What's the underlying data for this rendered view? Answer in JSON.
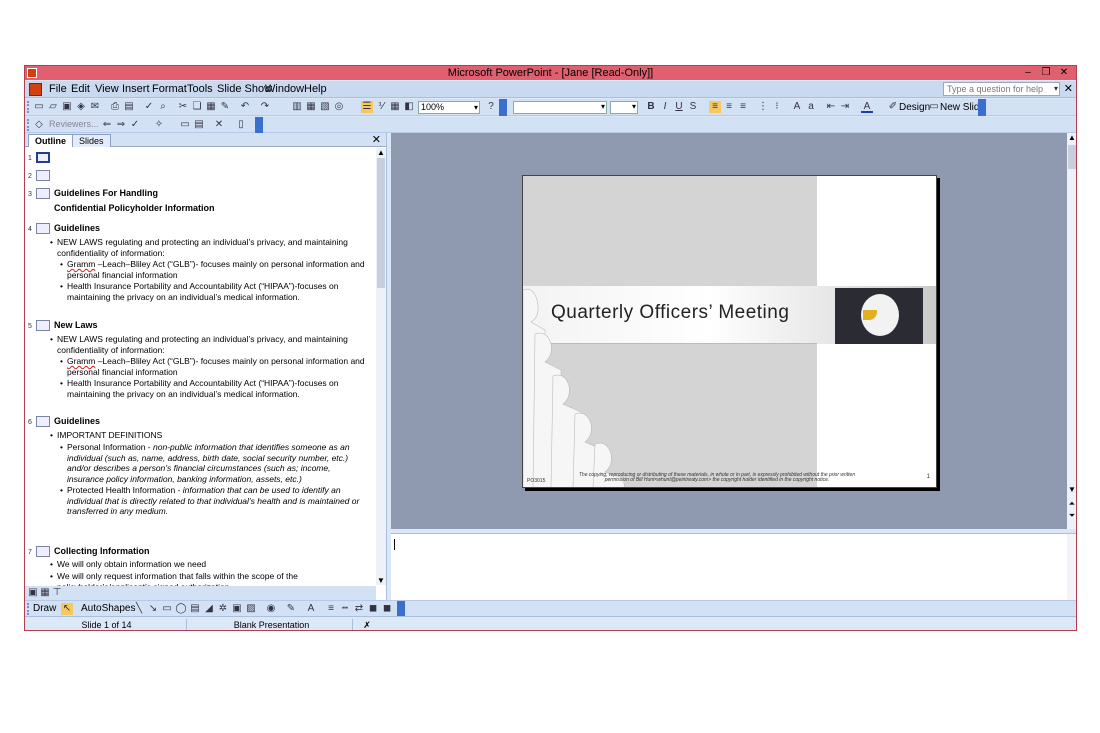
{
  "window": {
    "title": "Microsoft PowerPoint - [Jane [Read-Only]]"
  },
  "menubar": {
    "items": [
      "File",
      "Edit",
      "View",
      "Insert",
      "Format",
      "Tools",
      "Slide Show",
      "Window",
      "Help"
    ],
    "help_placeholder": "Type a question for help"
  },
  "toolbar": {
    "zoom": "100%",
    "design_label": "Design",
    "new_slide_label": "New Slide",
    "reviewers_label": "Reviewers..."
  },
  "left_pane": {
    "tabs": [
      "Outline",
      "Slides"
    ],
    "slides": [
      {
        "num": "1",
        "title": ""
      },
      {
        "num": "2",
        "title": ""
      },
      {
        "num": "3",
        "title": "Guidelines For Handling",
        "subtitle": "Confidential Policyholder Information"
      },
      {
        "num": "4",
        "title": "Guidelines",
        "b1": "NEW LAWS regulating and protecting an individual’s privacy, and maintaining confidentiality of information:",
        "b2a_word": "Gramm",
        "b2a_rest": " –Leach–Bliley Act (“GLB”)- focuses mainly on personal information and personal financial information",
        "b2b": "Health Insurance Portability and Accountability Act (“HIPAA”)-focuses on maintaining the privacy on an individual’s medical information."
      },
      {
        "num": "5",
        "title": "New Laws",
        "b1": "NEW LAWS regulating and protecting an individual’s privacy, and maintaining confidentiality of information:",
        "b2a_word": "Gramm",
        "b2a_rest": " –Leach–Bliley Act (“GLB”)- focuses mainly on personal information and personal financial information",
        "b2b": "Health Insurance Portability and Accountability Act (“HIPAA”)-focuses on maintaining the privacy on an individual’s medical information."
      },
      {
        "num": "6",
        "title": "Guidelines",
        "b1": "IMPORTANT DEFINITIONS",
        "b2a_head": "Personal Information - ",
        "b2a_it": "non-public information that identifies someone as an individual (such as, name, address, birth date, social security number, etc.) and/or describes a person’s financial circumstances (such as; income, insurance policy information, banking information, assets, etc.)",
        "b2b_head": "Protected Health Information - ",
        "b2b_it": "information that can be used to identify an individual that is directly related to that individual’s health and is maintained or transferred in any medium."
      },
      {
        "num": "7",
        "title": "Collecting Information",
        "b1a": "We will only obtain information we need",
        "b1b": "We will only request information that falls within the scope of the policyholder’s/applicant’s signed authorization"
      }
    ]
  },
  "slide": {
    "title": "Quarterly Officers’ Meeting",
    "footer": "The copying, reproducing or distributing of these materials, in whole or in part, is expressly prohibited without the prior written permission of Bill Hunt<whunt@peintreaty.com> the copyright holder identified in the copyright notice.",
    "code": "PO3015",
    "number": "1"
  },
  "status": {
    "slide_of": "Slide 1 of 14",
    "design": "Blank Presentation"
  },
  "drawbar": {
    "draw_label": "Draw",
    "autoshapes_label": "AutoShapes"
  },
  "colors": {
    "titlebar": "#e06070",
    "chrome": "#d3e1f4",
    "slide_area": "#8f99b0"
  }
}
